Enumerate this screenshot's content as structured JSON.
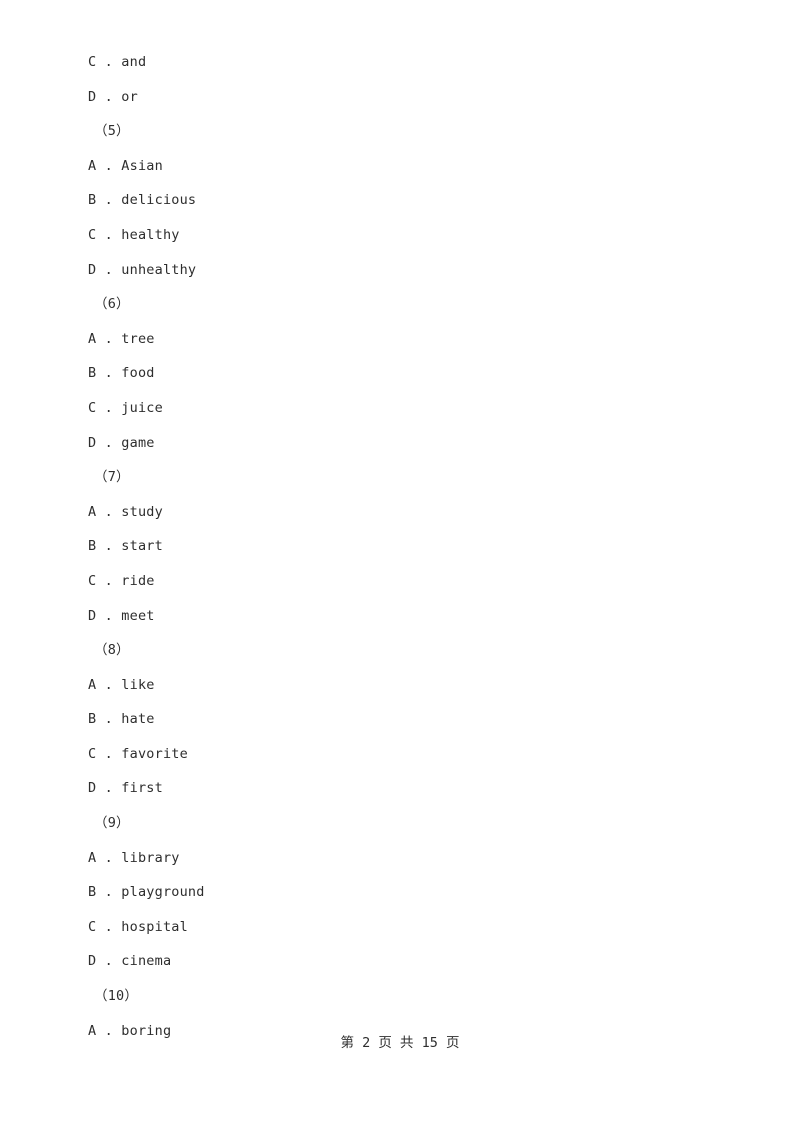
{
  "document": {
    "type": "exam-paper",
    "page_number": 2,
    "total_pages": 15,
    "background_color": "#ffffff",
    "text_color": "#2e2e2e"
  },
  "lines": [
    {
      "kind": "option",
      "text": "C . and"
    },
    {
      "kind": "option",
      "text": "D . or"
    },
    {
      "kind": "question",
      "text": "（5）"
    },
    {
      "kind": "option",
      "text": "A . Asian"
    },
    {
      "kind": "option",
      "text": "B . delicious"
    },
    {
      "kind": "option",
      "text": "C . healthy"
    },
    {
      "kind": "option",
      "text": "D . unhealthy"
    },
    {
      "kind": "question",
      "text": "（6）"
    },
    {
      "kind": "option",
      "text": "A . tree"
    },
    {
      "kind": "option",
      "text": "B . food"
    },
    {
      "kind": "option",
      "text": "C . juice"
    },
    {
      "kind": "option",
      "text": "D . game"
    },
    {
      "kind": "question",
      "text": "（7）"
    },
    {
      "kind": "option",
      "text": "A . study"
    },
    {
      "kind": "option",
      "text": "B . start"
    },
    {
      "kind": "option",
      "text": "C . ride"
    },
    {
      "kind": "option",
      "text": "D . meet"
    },
    {
      "kind": "question",
      "text": "（8）"
    },
    {
      "kind": "option",
      "text": "A . like"
    },
    {
      "kind": "option",
      "text": "B . hate"
    },
    {
      "kind": "option",
      "text": "C . favorite"
    },
    {
      "kind": "option",
      "text": "D . first"
    },
    {
      "kind": "question",
      "text": "（9）"
    },
    {
      "kind": "option",
      "text": "A . library"
    },
    {
      "kind": "option",
      "text": "B . playground"
    },
    {
      "kind": "option",
      "text": "C . hospital"
    },
    {
      "kind": "option",
      "text": "D . cinema"
    },
    {
      "kind": "question",
      "text": "（10）"
    },
    {
      "kind": "option",
      "text": "A . boring"
    }
  ],
  "footer": {
    "text": "第 2 页 共 15 页"
  }
}
